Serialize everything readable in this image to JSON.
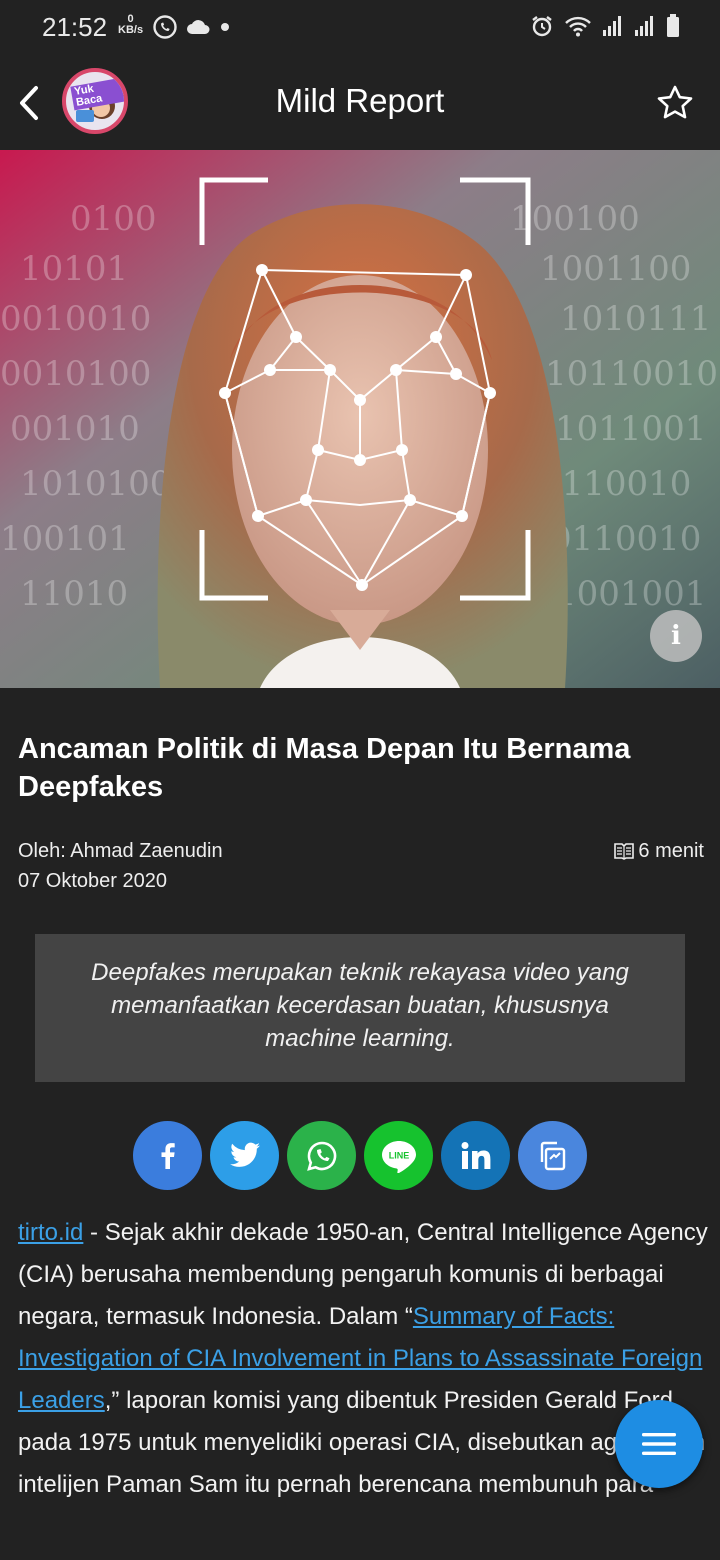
{
  "status_bar": {
    "time": "21:52",
    "net_speed_value": "0",
    "net_speed_unit": "KB/s"
  },
  "app_bar": {
    "title": "Mild Report",
    "logo_text": "Yuk Baca"
  },
  "article": {
    "headline": "Ancaman Politik di Masa Depan Itu Bernama Deepfakes",
    "author": "Oleh: Ahmad Zaenudin",
    "date": "07 Oktober 2020",
    "read_time": "6 menit",
    "quote": "Deepfakes merupakan teknik rekayasa video yang memanfaatkan kecerdasan buatan, khususnya machine learning.",
    "source_link": "tirto.id",
    "body_part1": " -  Sejak akhir dekade 1950-an, Central Intelligence Agency (CIA) berusaha membendung pengaruh komunis di berbagai negara, termasuk Indonesia. Dalam “",
    "report_link": "Summary of Facts: Investigation of CIA Involvement in Plans to Assassinate Foreign Leaders",
    "body_part2": ",” laporan komisi yang dibentuk Presiden Gerald Ford pada 1975 untuk menyelidiki operasi CIA, disebutkan agen-agen intelijen Paman Sam itu pernah berencana membunuh para"
  },
  "share": {
    "buttons": [
      {
        "icon": "facebook-icon",
        "color": "#3b7ddd"
      },
      {
        "icon": "twitter-icon",
        "color": "#2d9ee8"
      },
      {
        "icon": "whatsapp-icon",
        "color": "#2bb24a"
      },
      {
        "icon": "line-icon",
        "color": "#16c22e"
      },
      {
        "icon": "linkedin-icon",
        "color": "#1473b6"
      },
      {
        "icon": "copy-icon",
        "color": "#4a86dd"
      }
    ]
  },
  "colors": {
    "background": "#222222",
    "quote_background": "#444444",
    "link": "#3ba0e6",
    "fab": "#1e8de3"
  }
}
